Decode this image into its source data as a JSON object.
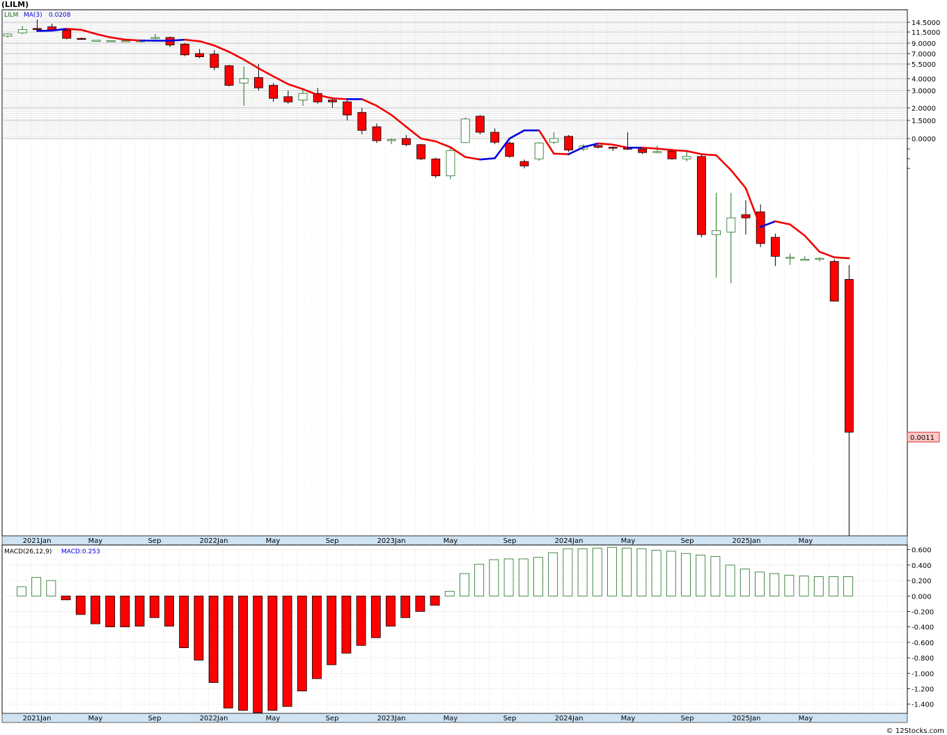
{
  "ticker": "(LILM)",
  "copyright": "© 12Stocks.com",
  "colors": {
    "up": "#1b6e1b",
    "down": "#ff0000",
    "ma_up": "#0000dd",
    "ma_down": "#ee0000",
    "grid": "#c8c8c8",
    "axis_band": "#cfe3f3"
  },
  "chart_data": [
    {
      "type": "candlestick",
      "legend": {
        "symbol": "LILM",
        "ma_label": "MA(3)",
        "ma_value": "0.0208"
      },
      "scale": "log",
      "y_tick_labels": [
        "14.5000",
        "11.5000",
        "9.0000",
        "7.0000",
        "5.5000",
        "4.0000",
        "3.0000",
        "2.0000",
        "1.5000",
        "0.0000"
      ],
      "last_price_label": "0.0011",
      "x_tick_labels": [
        "2021Jan",
        "May",
        "Sep",
        "2022Jan",
        "May",
        "Sep",
        "2023Jan",
        "May",
        "Sep",
        "2024Jan",
        "May",
        "Sep",
        "2025Jan",
        "May"
      ],
      "candles": [
        {
          "o": 10.5,
          "h": 11.2,
          "l": 10.2,
          "c": 11.0
        },
        {
          "o": 11.3,
          "h": 13.2,
          "l": 11.0,
          "c": 12.2
        },
        {
          "o": 12.5,
          "h": 15.5,
          "l": 11.8,
          "c": 12.2
        },
        {
          "o": 13.0,
          "h": 14.0,
          "l": 12.0,
          "c": 12.0
        },
        {
          "o": 12.0,
          "h": 12.3,
          "l": 9.8,
          "c": 10.0
        },
        {
          "o": 10.0,
          "h": 10.2,
          "l": 9.7,
          "c": 9.8
        },
        {
          "o": 9.6,
          "h": 9.6,
          "l": 9.6,
          "c": 9.6
        },
        {
          "o": 9.5,
          "h": 9.5,
          "l": 9.5,
          "c": 9.5
        },
        {
          "o": 9.5,
          "h": 9.5,
          "l": 9.5,
          "c": 9.5
        },
        {
          "o": 9.5,
          "h": 9.5,
          "l": 9.5,
          "c": 9.5
        },
        {
          "o": 10.0,
          "h": 11.0,
          "l": 9.8,
          "c": 10.2
        },
        {
          "o": 10.2,
          "h": 10.4,
          "l": 8.2,
          "c": 8.6
        },
        {
          "o": 8.8,
          "h": 9.0,
          "l": 6.6,
          "c": 6.8
        },
        {
          "o": 7.0,
          "h": 7.8,
          "l": 6.3,
          "c": 6.5
        },
        {
          "o": 6.9,
          "h": 7.6,
          "l": 4.8,
          "c": 5.1
        },
        {
          "o": 5.3,
          "h": 5.4,
          "l": 3.3,
          "c": 3.4
        },
        {
          "o": 3.6,
          "h": 5.2,
          "l": 2.1,
          "c": 4.0
        },
        {
          "o": 4.1,
          "h": 5.5,
          "l": 3.0,
          "c": 3.2
        },
        {
          "o": 3.4,
          "h": 3.6,
          "l": 2.3,
          "c": 2.5
        },
        {
          "o": 2.6,
          "h": 3.0,
          "l": 2.2,
          "c": 2.3
        },
        {
          "o": 2.4,
          "h": 3.0,
          "l": 2.1,
          "c": 2.8
        },
        {
          "o": 2.8,
          "h": 3.2,
          "l": 2.2,
          "c": 2.3
        },
        {
          "o": 2.4,
          "h": 2.5,
          "l": 2.0,
          "c": 2.3
        },
        {
          "o": 2.3,
          "h": 2.4,
          "l": 1.5,
          "c": 1.7
        },
        {
          "o": 1.8,
          "h": 2.0,
          "l": 1.1,
          "c": 1.2
        },
        {
          "o": 1.3,
          "h": 1.4,
          "l": 0.88,
          "c": 0.94
        },
        {
          "o": 0.94,
          "h": 1.0,
          "l": 0.85,
          "c": 0.97
        },
        {
          "o": 1.0,
          "h": 1.08,
          "l": 0.8,
          "c": 0.84
        },
        {
          "o": 0.84,
          "h": 0.86,
          "l": 0.54,
          "c": 0.56
        },
        {
          "o": 0.56,
          "h": 0.58,
          "l": 0.33,
          "c": 0.35
        },
        {
          "o": 0.35,
          "h": 0.78,
          "l": 0.32,
          "c": 0.71
        },
        {
          "o": 0.89,
          "h": 1.6,
          "l": 0.88,
          "c": 1.55
        },
        {
          "o": 1.65,
          "h": 1.7,
          "l": 1.1,
          "c": 1.15
        },
        {
          "o": 1.15,
          "h": 1.25,
          "l": 0.85,
          "c": 0.9
        },
        {
          "o": 0.88,
          "h": 0.92,
          "l": 0.58,
          "c": 0.6
        },
        {
          "o": 0.52,
          "h": 0.55,
          "l": 0.43,
          "c": 0.46
        },
        {
          "o": 0.56,
          "h": 0.9,
          "l": 0.53,
          "c": 0.88
        },
        {
          "o": 0.9,
          "h": 1.15,
          "l": 0.86,
          "c": 1.0
        },
        {
          "o": 1.05,
          "h": 1.08,
          "l": 0.68,
          "c": 0.72
        },
        {
          "o": 0.74,
          "h": 0.85,
          "l": 0.7,
          "c": 0.81
        },
        {
          "o": 0.82,
          "h": 0.84,
          "l": 0.75,
          "c": 0.78
        },
        {
          "o": 0.78,
          "h": 0.8,
          "l": 0.7,
          "c": 0.76
        },
        {
          "o": 0.76,
          "h": 1.15,
          "l": 0.72,
          "c": 0.74
        },
        {
          "o": 0.74,
          "h": 0.76,
          "l": 0.64,
          "c": 0.67
        },
        {
          "o": 0.68,
          "h": 0.82,
          "l": 0.66,
          "c": 0.69
        },
        {
          "o": 0.7,
          "h": 0.72,
          "l": 0.55,
          "c": 0.56
        },
        {
          "o": 0.56,
          "h": 0.68,
          "l": 0.52,
          "c": 0.6
        },
        {
          "o": 0.6,
          "h": 0.64,
          "l": 0.065,
          "c": 0.07
        },
        {
          "o": 0.07,
          "h": 0.22,
          "l": 0.022,
          "c": 0.078
        },
        {
          "o": 0.075,
          "h": 0.22,
          "l": 0.019,
          "c": 0.11
        },
        {
          "o": 0.12,
          "h": 0.18,
          "l": 0.07,
          "c": 0.11
        },
        {
          "o": 0.13,
          "h": 0.16,
          "l": 0.05,
          "c": 0.055
        },
        {
          "o": 0.065,
          "h": 0.072,
          "l": 0.03,
          "c": 0.039
        },
        {
          "o": 0.038,
          "h": 0.042,
          "l": 0.031,
          "c": 0.038
        },
        {
          "o": 0.036,
          "h": 0.039,
          "l": 0.035,
          "c": 0.036
        },
        {
          "o": 0.036,
          "h": 0.038,
          "l": 0.034,
          "c": 0.037
        },
        {
          "o": 0.034,
          "h": 0.036,
          "l": 0.012,
          "c": 0.012
        },
        {
          "o": 0.021,
          "h": 0.031,
          "l": 0.0006,
          "c": 0.0011
        }
      ],
      "ma": [
        11.8,
        11.9,
        12.4,
        12.1,
        11.0,
        10.2,
        9.7,
        9.55,
        9.5,
        9.5,
        9.7,
        9.4,
        8.5,
        7.3,
        6.1,
        5.0,
        4.2,
        3.5,
        3.1,
        2.7,
        2.5,
        2.45,
        2.45,
        2.1,
        1.7,
        1.3,
        1.0,
        0.92,
        0.78,
        0.59,
        0.55,
        0.57,
        1.0,
        1.2,
        1.2,
        0.65,
        0.64,
        0.78,
        0.87,
        0.84,
        0.77,
        0.77,
        0.75,
        0.72,
        0.7,
        0.64,
        0.62,
        0.41,
        0.25,
        0.086,
        0.1,
        0.092,
        0.068,
        0.044,
        0.038,
        0.037,
        0.028,
        0.017
      ]
    },
    {
      "type": "bar",
      "legend": {
        "label": "MACD(26,12,9)",
        "value_label": "MACD:0.253"
      },
      "y_tick_labels": [
        "0.600",
        "0.400",
        "0.200",
        "0.000",
        "-0.200",
        "-0.400",
        "-0.600",
        "-0.800",
        "-1.000",
        "-1.200",
        "-1.400"
      ],
      "ylim": [
        -1.52,
        0.66
      ],
      "x_tick_labels": [
        "2021Jan",
        "May",
        "Sep",
        "2022Jan",
        "May",
        "Sep",
        "2023Jan",
        "May",
        "Sep",
        "2024Jan",
        "May",
        "Sep",
        "2025Jan",
        "May"
      ],
      "values": [
        0.12,
        0.24,
        0.2,
        -0.05,
        -0.24,
        -0.36,
        -0.4,
        -0.4,
        -0.39,
        -0.28,
        -0.39,
        -0.67,
        -0.83,
        -1.12,
        -1.45,
        -1.48,
        -1.51,
        -1.48,
        -1.43,
        -1.23,
        -1.07,
        -0.89,
        -0.74,
        -0.64,
        -0.54,
        -0.39,
        -0.28,
        -0.2,
        -0.12,
        0.06,
        0.29,
        0.41,
        0.47,
        0.48,
        0.48,
        0.5,
        0.56,
        0.61,
        0.61,
        0.62,
        0.63,
        0.62,
        0.61,
        0.59,
        0.58,
        0.55,
        0.53,
        0.51,
        0.4,
        0.35,
        0.31,
        0.29,
        0.27,
        0.26,
        0.25,
        0.25,
        0.25,
        0.25,
        0.25,
        0.253
      ]
    }
  ]
}
